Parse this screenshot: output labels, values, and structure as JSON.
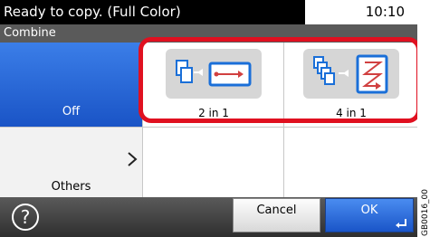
{
  "status": {
    "message": "Ready to copy. (Full Color)",
    "time": "10:10"
  },
  "title": "Combine",
  "left_menu": {
    "off_label": "Off",
    "others_label": "Others"
  },
  "options": [
    {
      "label": "2 in 1",
      "icon": "2-in-1-icon"
    },
    {
      "label": "4 in 1",
      "icon": "4-in-1-icon"
    }
  ],
  "buttons": {
    "help": "?",
    "cancel": "Cancel",
    "ok": "OK"
  },
  "side_code": "GB0016_00",
  "colors": {
    "highlight": "#e01020",
    "selected": "#1a54c6",
    "status_bg": "#000000"
  }
}
